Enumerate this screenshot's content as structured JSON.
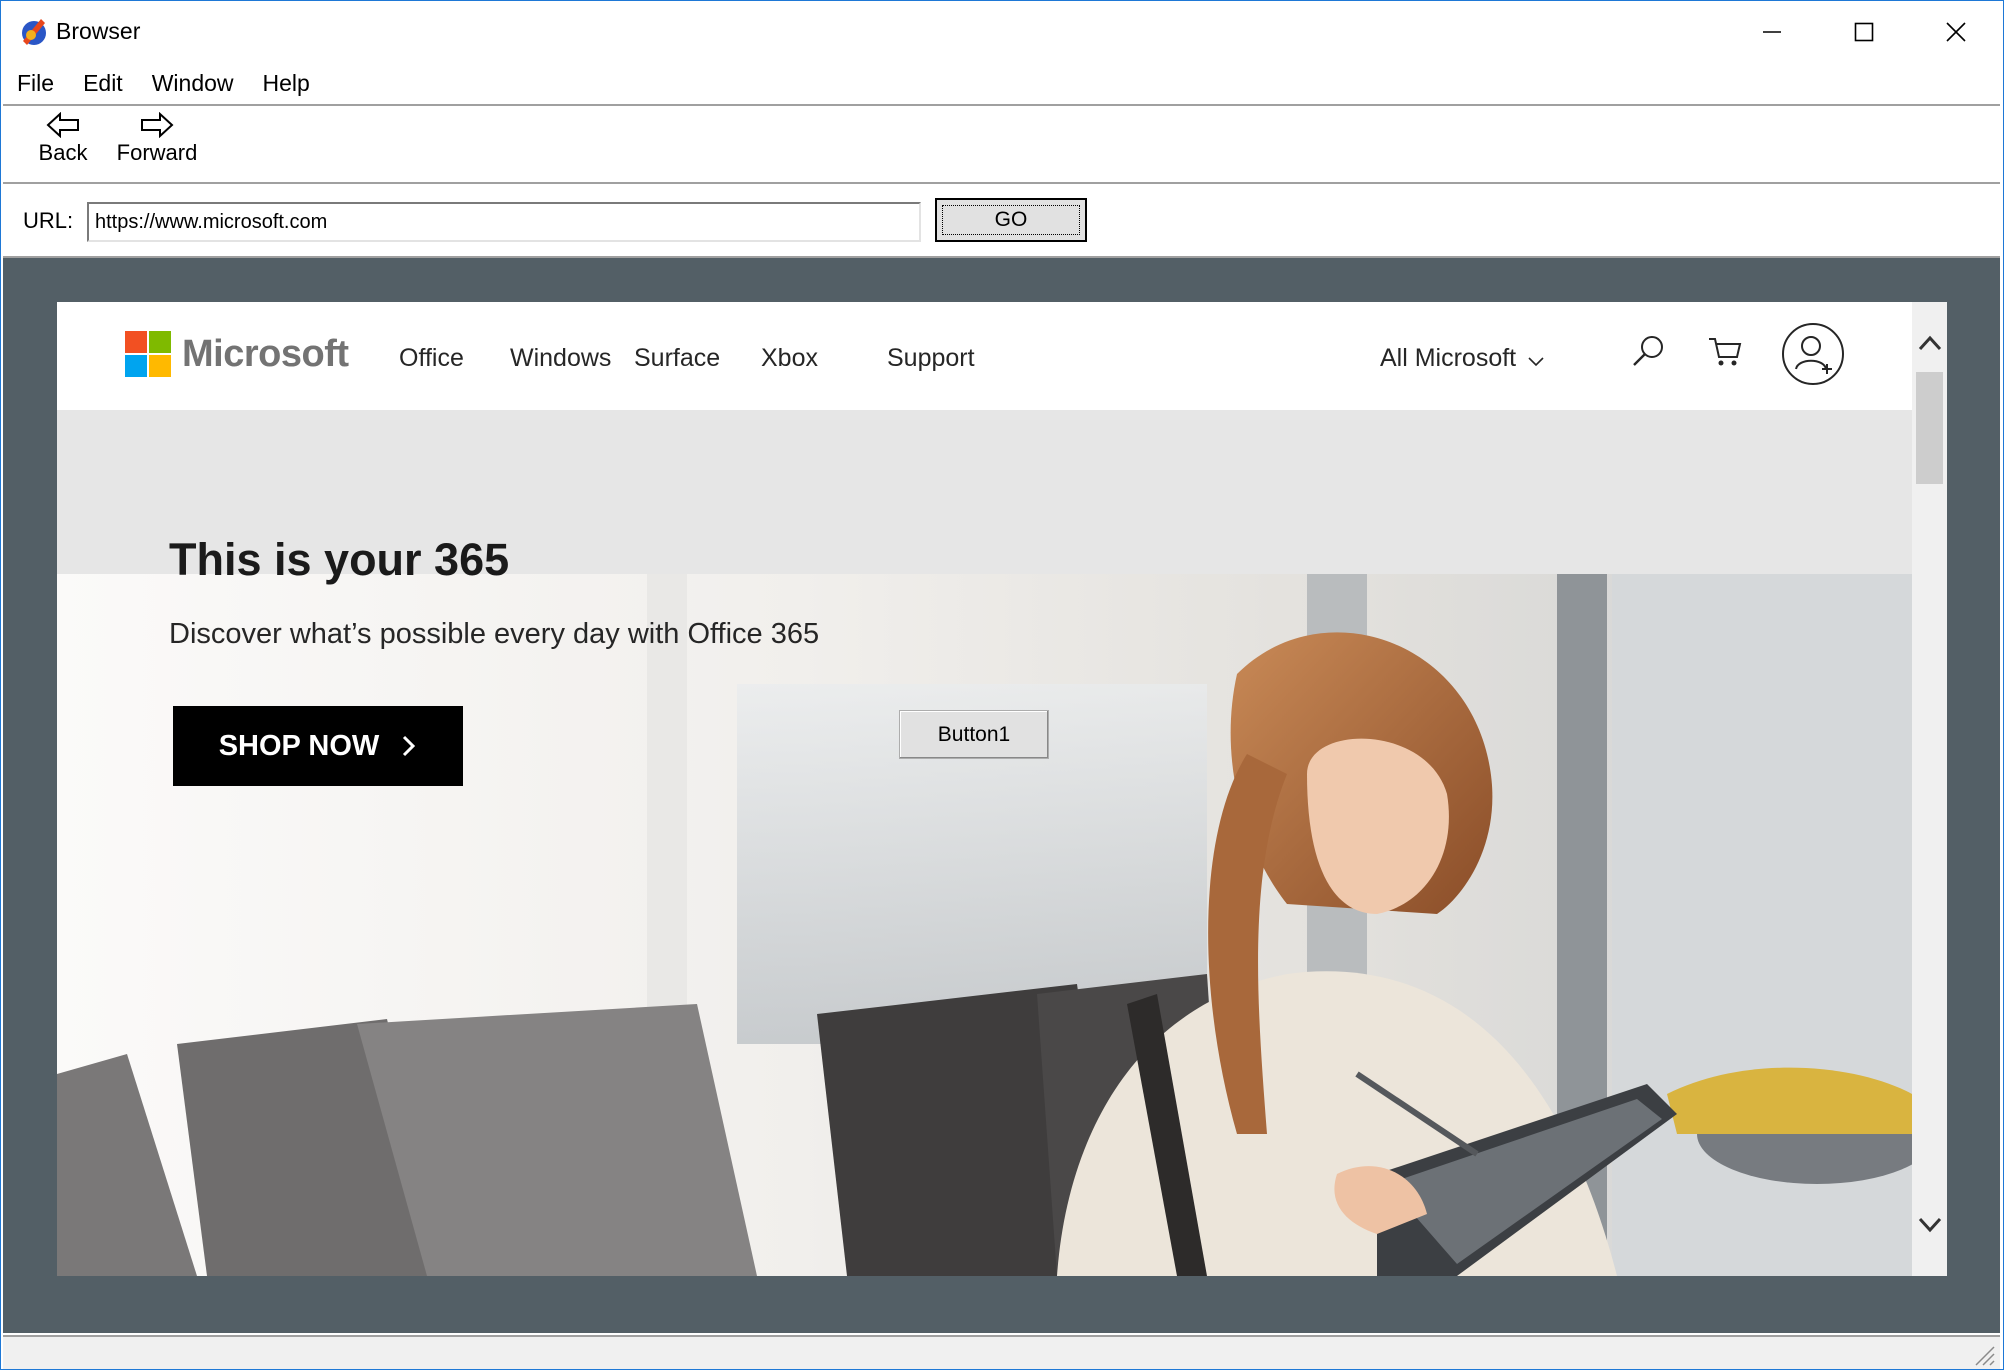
{
  "window": {
    "title": "Browser",
    "icon": "browser-app-icon",
    "controls": {
      "minimize": "minimize-icon",
      "maximize": "maximize-icon",
      "close": "close-icon"
    }
  },
  "menu": {
    "items": [
      "File",
      "Edit",
      "Window",
      "Help"
    ]
  },
  "toolbar": {
    "back_label": "Back",
    "forward_label": "Forward"
  },
  "urlbar": {
    "label": "URL:",
    "value": "https://www.microsoft.com",
    "go_label": "GO"
  },
  "site": {
    "logo_text": "Microsoft",
    "logo_colors": [
      "#f25022",
      "#7fba00",
      "#00a4ef",
      "#ffb900"
    ],
    "nav": [
      "Office",
      "Windows",
      "Surface",
      "Xbox",
      "Support"
    ],
    "all_microsoft": "All Microsoft",
    "icons": [
      "search-icon",
      "cart-icon",
      "account-icon"
    ]
  },
  "hero": {
    "title": "This is your 365",
    "subtitle": "Discover what’s possible every day with Office 365",
    "cta": "SHOP NOW",
    "overlay_button": "Button1"
  },
  "colors": {
    "client_bg": "#535f66",
    "window_border": "#1e78d6"
  }
}
